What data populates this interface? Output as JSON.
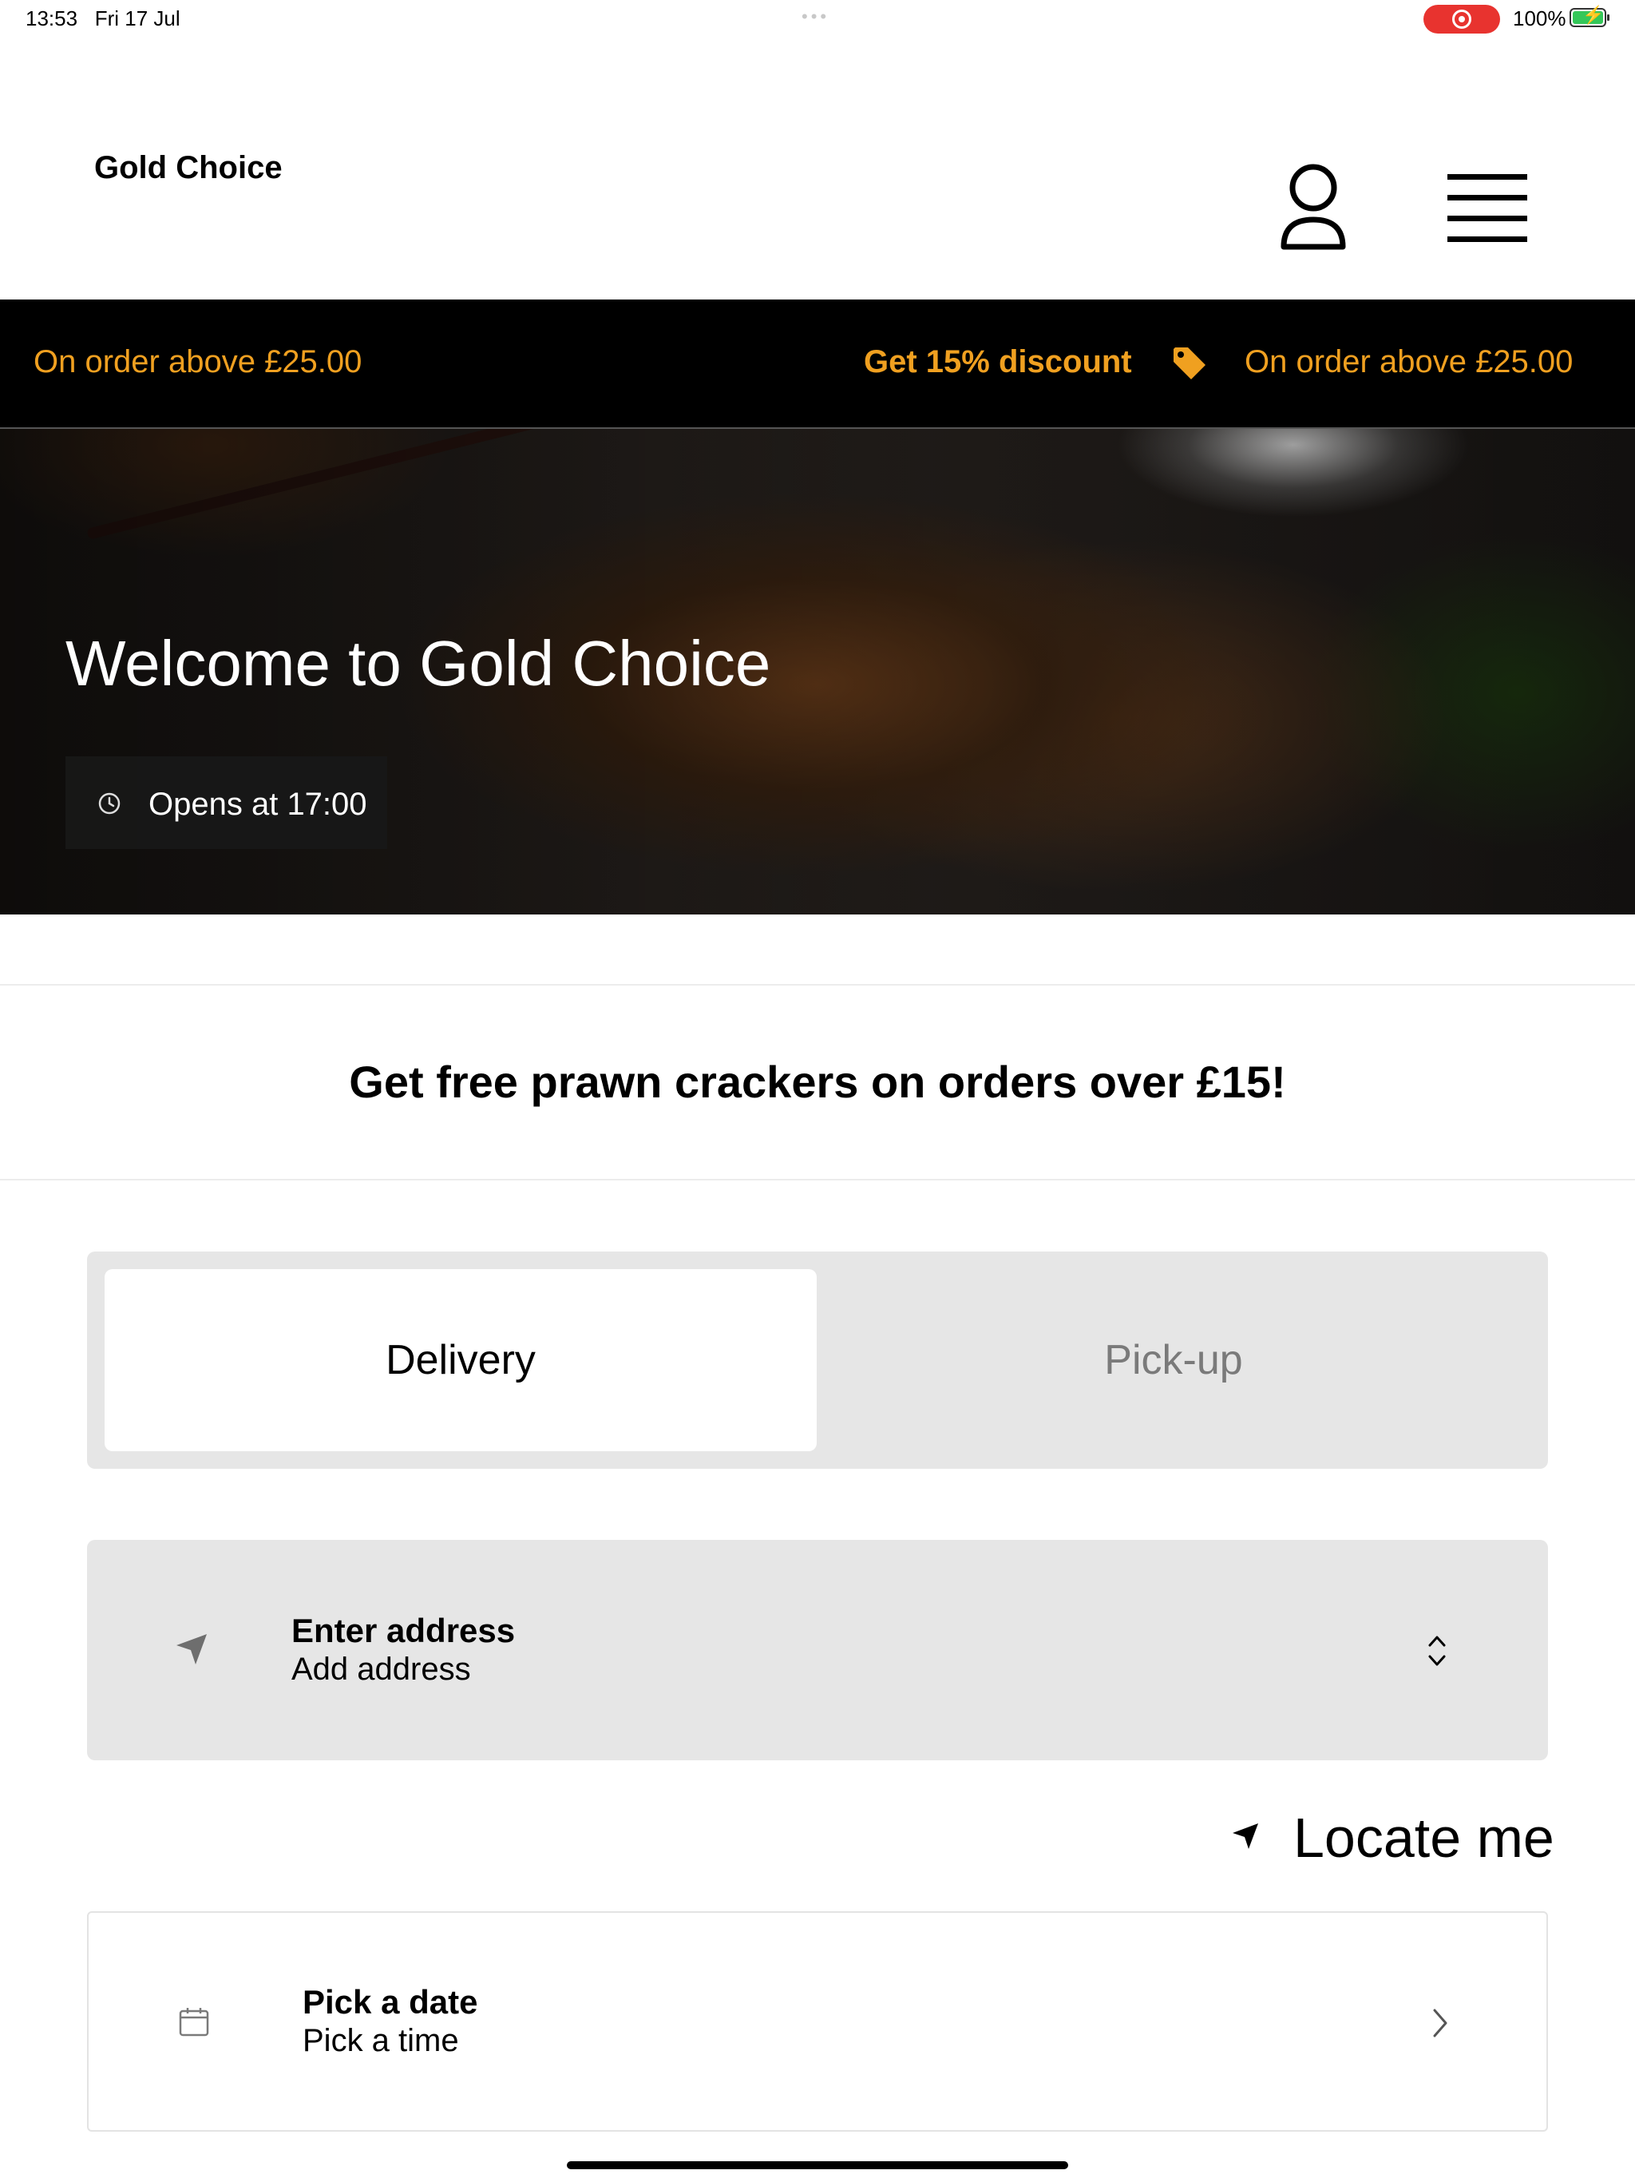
{
  "status_bar": {
    "time": "13:53",
    "date": "Fri 17 Jul",
    "battery": "100%"
  },
  "header": {
    "brand": "Gold Choice",
    "icons": [
      "user-icon",
      "menu-icon"
    ]
  },
  "promo": {
    "left_text": "On order above £25.00",
    "discount_text": "Get 15% discount",
    "right_text": "On order above £25.00",
    "accent_color": "#f0a020"
  },
  "hero": {
    "title": "Welcome to Gold Choice",
    "opens_text": "Opens at 17:00"
  },
  "offer": {
    "text": "Get free prawn crackers on orders over £15!"
  },
  "order_type": {
    "selected": "Delivery",
    "options": [
      "Delivery",
      "Pick-up"
    ]
  },
  "address": {
    "title": "Enter address",
    "placeholder": "Add address"
  },
  "locate": {
    "label": "Locate me"
  },
  "schedule": {
    "date_label": "Pick a date",
    "time_label": "Pick a time"
  }
}
